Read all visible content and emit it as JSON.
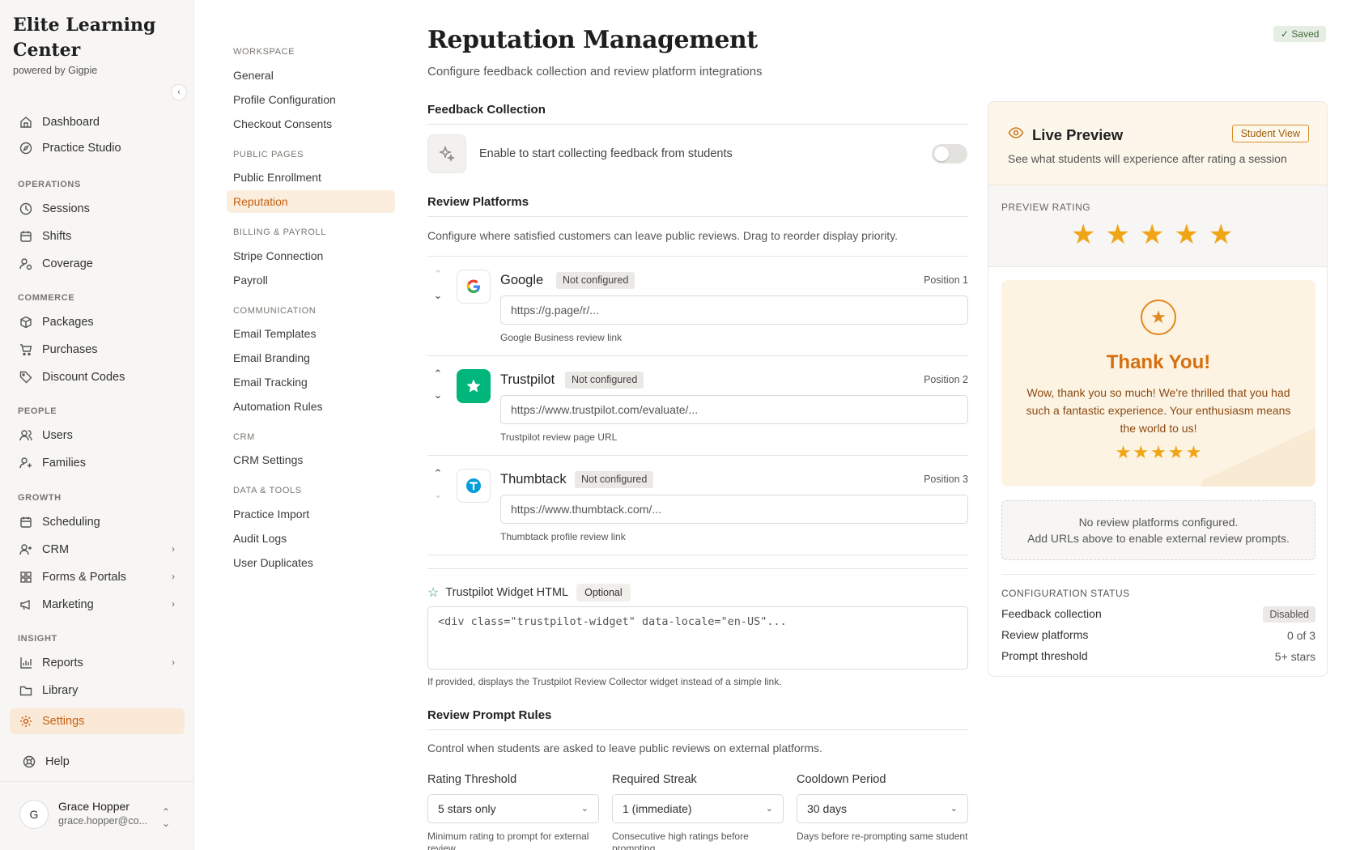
{
  "brand": {
    "name": "Elite Learning Center",
    "powered_by": "powered by Gigpie"
  },
  "sidebar": {
    "sections": {
      "operations": "OPERATIONS",
      "commerce": "COMMERCE",
      "people": "PEOPLE",
      "growth": "GROWTH",
      "insight": "INSIGHT"
    },
    "items": {
      "dashboard": "Dashboard",
      "practice_studio": "Practice Studio",
      "sessions": "Sessions",
      "shifts": "Shifts",
      "coverage": "Coverage",
      "packages": "Packages",
      "purchases": "Purchases",
      "discount_codes": "Discount Codes",
      "users": "Users",
      "families": "Families",
      "scheduling": "Scheduling",
      "crm": "CRM",
      "forms_portals": "Forms & Portals",
      "marketing": "Marketing",
      "reports": "Reports",
      "library": "Library",
      "settings": "Settings",
      "help": "Help"
    },
    "user": {
      "initial": "G",
      "name": "Grace Hopper",
      "email": "grace.hopper@co..."
    }
  },
  "subnav": {
    "sections": {
      "workspace": "WORKSPACE",
      "public_pages": "PUBLIC PAGES",
      "billing": "BILLING & PAYROLL",
      "communication": "COMMUNICATION",
      "crm": "CRM",
      "data_tools": "DATA & TOOLS"
    },
    "items": {
      "general": "General",
      "profile_configuration": "Profile Configuration",
      "checkout_consents": "Checkout Consents",
      "public_enrollment": "Public Enrollment",
      "reputation": "Reputation",
      "stripe_connection": "Stripe Connection",
      "payroll": "Payroll",
      "email_templates": "Email Templates",
      "email_branding": "Email Branding",
      "email_tracking": "Email Tracking",
      "automation_rules": "Automation Rules",
      "crm_settings": "CRM Settings",
      "practice_import": "Practice Import",
      "audit_logs": "Audit Logs",
      "user_duplicates": "User Duplicates"
    }
  },
  "page": {
    "title": "Reputation Management",
    "description": "Configure feedback collection and review platform integrations",
    "saved": "✓ Saved"
  },
  "feedback": {
    "title": "Feedback Collection",
    "label": "Enable to start collecting feedback from students",
    "enabled": false
  },
  "review_platforms": {
    "title": "Review Platforms",
    "description": "Configure where satisfied customers can leave public reviews. Drag to reorder display priority.",
    "items": [
      {
        "name": "Google",
        "status": "Not configured",
        "position": "Position 1",
        "placeholder": "https://g.page/r/...",
        "help": "Google Business review link"
      },
      {
        "name": "Trustpilot",
        "status": "Not configured",
        "position": "Position 2",
        "placeholder": "https://www.trustpilot.com/evaluate/...",
        "help": "Trustpilot review page URL"
      },
      {
        "name": "Thumbtack",
        "status": "Not configured",
        "position": "Position 3",
        "placeholder": "https://www.thumbtack.com/...",
        "help": "Thumbtack profile review link"
      }
    ]
  },
  "widget": {
    "label": "Trustpilot Widget HTML",
    "optional": "Optional",
    "placeholder": "<div class=\"trustpilot-widget\" data-locale=\"en-US\"...",
    "help": "If provided, displays the Trustpilot Review Collector widget instead of a simple link."
  },
  "rules": {
    "title": "Review Prompt Rules",
    "description": "Control when students are asked to leave public reviews on external platforms.",
    "items": [
      {
        "label": "Rating Threshold",
        "value": "5 stars only",
        "hint": "Minimum rating to prompt for external review"
      },
      {
        "label": "Required Streak",
        "value": "1 (immediate)",
        "hint": "Consecutive high ratings before prompting"
      },
      {
        "label": "Cooldown Period",
        "value": "30 days",
        "hint": "Days before re-prompting same student"
      }
    ]
  },
  "preview": {
    "title": "Live Preview",
    "badge": "Student View",
    "subtitle": "See what students will experience after rating a session",
    "rating_label": "PREVIEW RATING",
    "rating": 5,
    "thank_title": "Thank You!",
    "thank_message": "Wow, thank you so much! We're thrilled that you had such a fantastic experience. Your enthusiasm means the world to us!",
    "no_platforms_line1": "No review platforms configured.",
    "no_platforms_line2": "Add URLs above to enable external review prompts.",
    "config_title": "CONFIGURATION STATUS",
    "config": [
      {
        "label": "Feedback collection",
        "value": "Disabled"
      },
      {
        "label": "Review platforms",
        "value": "0 of 3"
      },
      {
        "label": "Prompt threshold",
        "value": "5+ stars"
      }
    ]
  },
  "colors": {
    "accent": "#c85f0e",
    "star": "#f0a516",
    "trustpilot": "#00b67a"
  }
}
